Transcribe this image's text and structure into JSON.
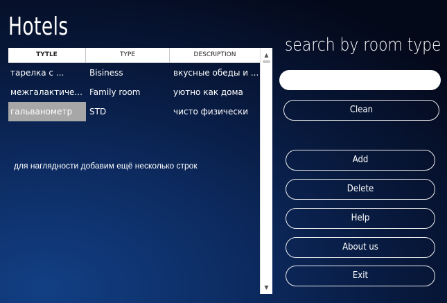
{
  "app": {
    "title": "Hotels",
    "note": "для наглядности добавим ещё несколько строк"
  },
  "table": {
    "columns": [
      "TYTLE",
      "TYPE",
      "DESCRIPTION"
    ],
    "rows": [
      {
        "title": "тарелка с ...",
        "type": "Bisiness",
        "description": "вкусные обеды и ..."
      },
      {
        "title": "межгалактиче...",
        "type": "Family room",
        "description": "уютно как дома"
      },
      {
        "title": "гальванометр",
        "type": "STD",
        "description": "чисто физически"
      }
    ],
    "selected_row": 2
  },
  "search": {
    "label": "search by room type",
    "value": "",
    "placeholder": ""
  },
  "buttons": {
    "clean": "Clean",
    "add": "Add",
    "delete": "Delete",
    "help": "Help",
    "about": "About us",
    "exit": "Exit"
  },
  "icons": {
    "scroll_up": "chevron-up-icon",
    "scroll_down": "chevron-down-icon"
  },
  "colors": {
    "background_dark": "#04091a",
    "background_blue": "#123f84",
    "selection": "#a7a7a7"
  }
}
